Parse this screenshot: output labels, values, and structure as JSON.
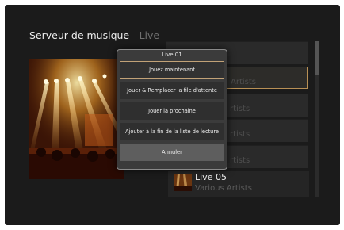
{
  "header": {
    "title": "Serveur de musique",
    "separator": "- ",
    "subtitle": "Live"
  },
  "list": {
    "partial_artists": [
      "Artists",
      "rtists",
      "rtists",
      "rtists"
    ],
    "last_item": {
      "title": "Live 05",
      "artist": "Various Artists"
    }
  },
  "popup": {
    "title": "Live 01",
    "options": [
      "Jouez maintenant",
      "Jouer & Remplacer la file d'attente",
      "Jouer la prochaine",
      "Ajouter à la fin de la liste de lecture"
    ],
    "cancel_label": "Annuler"
  },
  "colors": {
    "background": "#1b1b1b",
    "highlight": "#b89055",
    "cancel": "#5e5e5e"
  }
}
